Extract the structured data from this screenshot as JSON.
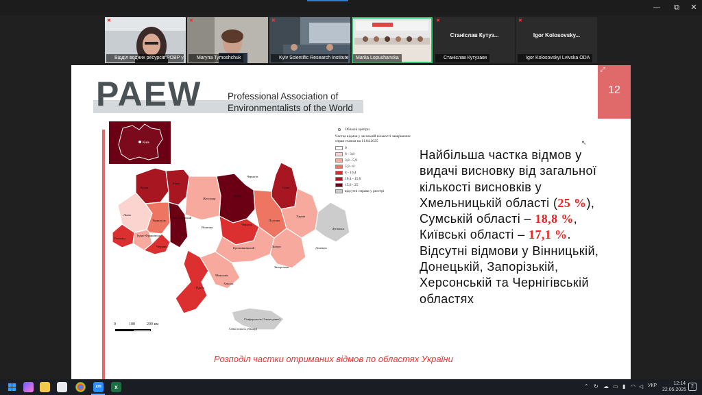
{
  "window": {
    "controls": {
      "minimize": "—",
      "maximize": "⧉",
      "close": "✕"
    }
  },
  "participants": [
    {
      "name": "Відділ водних ресурсів РОВР у ..."
    },
    {
      "name": "Maryna Tymoshchuk"
    },
    {
      "name": "Kyiv Scientific Research Institute"
    },
    {
      "name": "Mariia Lopushanska"
    },
    {
      "name": "Станіслав Кутузаки",
      "display": "Станіслав Кутуз..."
    },
    {
      "name": "Igor Kolosovskyi Lvivska ODA",
      "display": "Igor Kolosovsky..."
    }
  ],
  "slide": {
    "number": "12",
    "logo": {
      "acronym": "PAEW",
      "line1": "Professional Association of",
      "line2": "Environmentalists of the World"
    },
    "text": {
      "l1": "Найбільша частка відмов у",
      "l2": "видачі висновку від загальної",
      "l3": "кількості висновків у",
      "l4a": "Хмельницькій області (",
      "l4b": "25 %",
      "l4c": "),",
      "l5a": "Сумській області – ",
      "l5b": "18,8 %",
      "l5c": ",",
      "l6a": "Київські області – ",
      "l6b": "17,1 %",
      "l6c": ".",
      "l7": "Відсутні відмови у Вінницькій,",
      "l8": "Донецькій, Запорізькій,",
      "l9": "Херсонській та Чернігівській",
      "l10": "областях"
    },
    "caption": "Розподіл частки отриманих відмов по областях України",
    "inset_label": "Київ",
    "legend": {
      "point_label": "Обласні центри",
      "title": "Частка відмов у загальній кількості завершених справ станом на 11.04.2025",
      "classes": [
        {
          "label": "0",
          "color": "#ffffff"
        },
        {
          "label": "0 - 3,8",
          "color": "#fbd3cf"
        },
        {
          "label": "3,8 - 5,9",
          "color": "#f7a99e"
        },
        {
          "label": "5,9 - 8",
          "color": "#ef7563"
        },
        {
          "label": "8 - 10,4",
          "color": "#dc3030"
        },
        {
          "label": "10,4 - 15,6",
          "color": "#a81622"
        },
        {
          "label": "15,6 - 25",
          "color": "#6b0014"
        },
        {
          "label": "відсутні справи у реєстрі",
          "color": "#cccccc"
        }
      ]
    },
    "scalebar": {
      "t0": "0",
      "t1": "100",
      "t2": "200 км"
    },
    "cities": {
      "lutsk": "Луцьк",
      "rivne": "Рівне",
      "zhytomyr": "Житомир",
      "kyiv": "Київ",
      "chernihiv": "Чернігів",
      "sumy": "Суми",
      "lviv": "Львів",
      "ternopil": "Тернопіль",
      "khmelnytskyi": "Хмельницький",
      "vinnytsia": "Вінниця",
      "cherkasy": "Черкаси",
      "poltava": "Полтава",
      "kharkiv": "Харків",
      "luhansk": "Луганськ",
      "donetsk": "Донецьк",
      "ivanofrankivsk": "Івано-Франківськ",
      "uzhhorod": "Ужгород",
      "chernivtsi": "Чернівці",
      "kropyvnytskyi": "Кропивницький",
      "dnipro": "Дніпро",
      "zaporizhzhia": "Запоріжжя",
      "mykolaiv": "Миколаїв",
      "odesa": "Одеса",
      "kherson": "Херсон",
      "simferopol": "Сімферополь (Акмесджит)",
      "sevastopol": "Севастополь (Акъяр)"
    }
  },
  "taskbar": {
    "lang": "УКР",
    "time": "12:14",
    "date": "22.05.2025",
    "notif": "2"
  }
}
